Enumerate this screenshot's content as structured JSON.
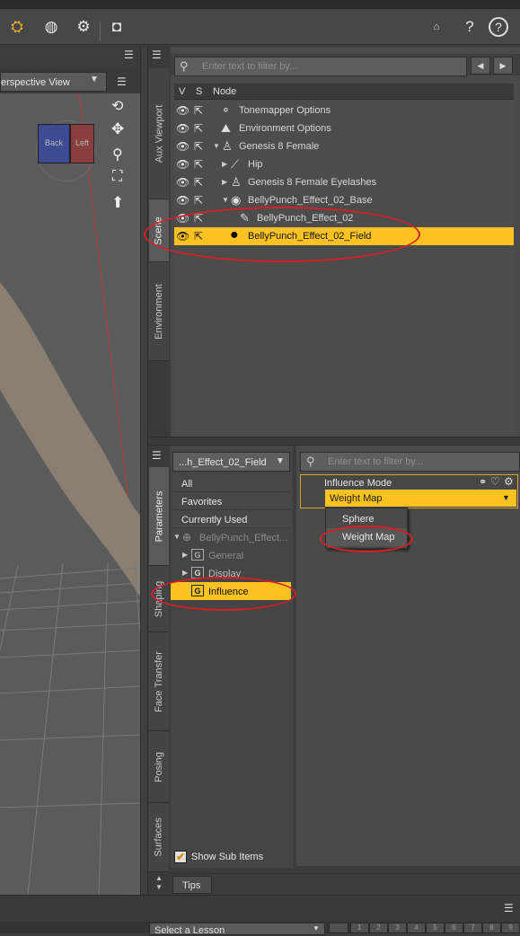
{
  "toolbar": {
    "icons": [
      "pointer-gear-icon",
      "sphere-gear-icon",
      "camera-gear-icon",
      "camera-icon",
      "ds-home-icon",
      "whats-this-icon",
      "help-icon"
    ]
  },
  "viewport": {
    "view_label": "erspective View",
    "cube_faces": [
      "Back",
      "Left"
    ]
  },
  "scene_tabs": [
    "Aux Viewport",
    "Scene",
    "Environment"
  ],
  "scene": {
    "filter_placeholder": "Enter text to filter by...",
    "columns": {
      "v": "V",
      "s": "S",
      "node": "Node"
    },
    "nodes": [
      {
        "label": "Tonemapper Options",
        "icon": "tonemapper-icon",
        "depth": 0,
        "expander": "none",
        "selected": false
      },
      {
        "label": "Environment Options",
        "icon": "environment-icon",
        "depth": 0,
        "expander": "none",
        "selected": false
      },
      {
        "label": "Genesis 8 Female",
        "icon": "figure-icon",
        "depth": 0,
        "expander": "expanded",
        "selected": false
      },
      {
        "label": "Hip",
        "icon": "bone-icon",
        "depth": 1,
        "expander": "collapsed",
        "selected": false
      },
      {
        "label": "Genesis 8 Female Eyelashes",
        "icon": "figure-icon",
        "depth": 1,
        "expander": "collapsed",
        "selected": false
      },
      {
        "label": "BellyPunch_Effect_02_Base",
        "icon": "dforce-modifier-icon",
        "depth": 1,
        "expander": "expanded",
        "selected": false
      },
      {
        "label": "BellyPunch_Effect_02",
        "icon": "weight-brush-icon",
        "depth": 2,
        "expander": "none",
        "selected": false
      },
      {
        "label": "BellyPunch_Effect_02_Field",
        "icon": "field-node-icon",
        "depth": 0,
        "expander": "none",
        "selected": true
      }
    ]
  },
  "param_tabs": [
    "Parameters",
    "Shaping",
    "Face Transfer",
    "Posing",
    "Surfaces"
  ],
  "parameters": {
    "node_select": "...h_Effect_02_Field",
    "filter_placeholder": "Enter text to filter by...",
    "list": [
      "All",
      "Favorites",
      "Currently Used"
    ],
    "group_root": "BellyPunch_Effect...",
    "groups": [
      "General",
      "Display",
      "Influence"
    ],
    "selected_group": "Influence",
    "show_sub_items": "Show Sub Items",
    "property": {
      "label": "Influence Mode",
      "value": "Weight Map",
      "options": [
        "Sphere",
        "Weight Map"
      ]
    }
  },
  "bottom": {
    "tips_tab": "Tips",
    "lesson_select": "Select a Lesson",
    "pages": [
      "1",
      "2",
      "3",
      "4",
      "5",
      "6",
      "7",
      "8",
      "9"
    ]
  },
  "colors": {
    "selection": "#fcc21f",
    "annotation": "#d61f26"
  }
}
